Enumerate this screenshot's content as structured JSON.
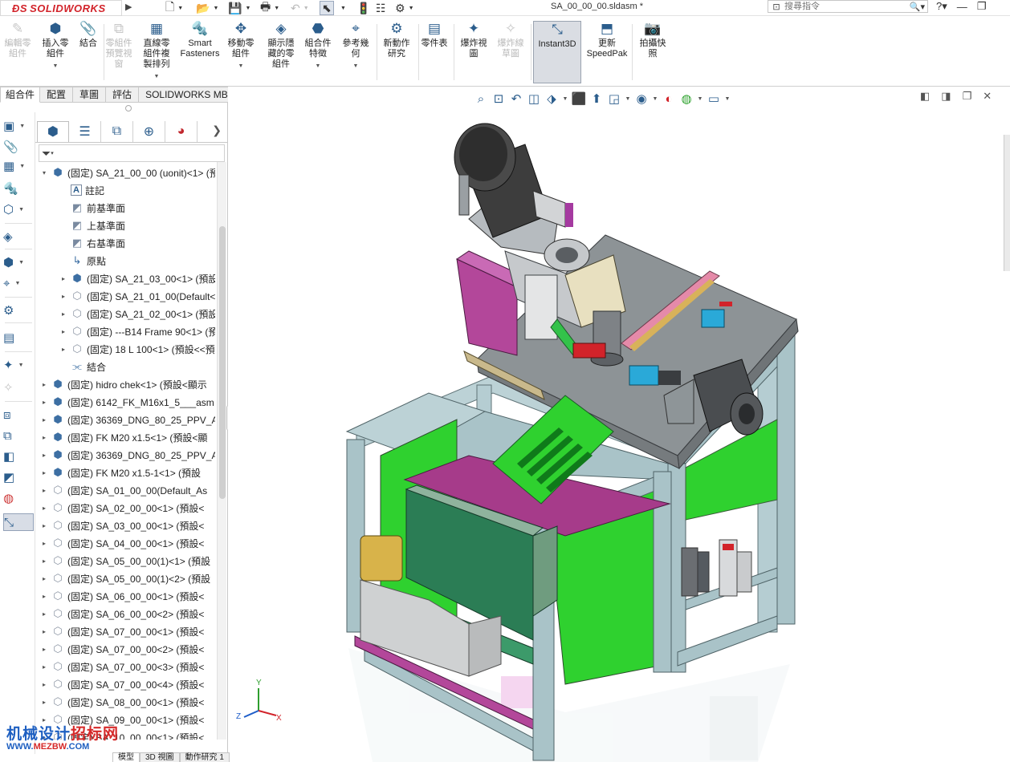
{
  "app": {
    "brand": "SOLIDWORKS",
    "document_title": "SA_00_00_00.sldasm *"
  },
  "search": {
    "placeholder": "搜尋指令"
  },
  "ribbon": [
    {
      "label": "編輯零\n組件",
      "icon": "edit-component-icon",
      "disabled": true
    },
    {
      "label": "插入零\n組件",
      "icon": "insert-component-icon",
      "disabled": false,
      "dropdown": true
    },
    {
      "label": "結合",
      "icon": "mate-icon",
      "disabled": false
    },
    {
      "label": "零組件\n預覽視\n窗",
      "icon": "component-preview-icon",
      "disabled": true
    },
    {
      "label": "直線零\n組件複\n製排列",
      "icon": "linear-pattern-icon",
      "disabled": false,
      "dropdown": true
    },
    {
      "label": "Smart\nFasteners",
      "icon": "smart-fasteners-icon",
      "disabled": false
    },
    {
      "label": "移動零\n組件",
      "icon": "move-component-icon",
      "disabled": false,
      "dropdown": true
    },
    {
      "label": "顯示隱\n藏的零\n組件",
      "icon": "show-hidden-icon",
      "disabled": false
    },
    {
      "label": "組合件\n特徵",
      "icon": "assembly-features-icon",
      "disabled": false,
      "dropdown": true
    },
    {
      "label": "參考幾\n何",
      "icon": "reference-geometry-icon",
      "disabled": false,
      "dropdown": true
    },
    {
      "label": "新動作\n研究",
      "icon": "motion-study-icon",
      "disabled": false
    },
    {
      "label": "零件表",
      "icon": "bom-icon",
      "disabled": false
    },
    {
      "label": "爆炸視\n圖",
      "icon": "exploded-view-icon",
      "disabled": false
    },
    {
      "label": "爆炸線\n草圖",
      "icon": "explode-line-sketch-icon",
      "disabled": true
    },
    {
      "label": "Instant3D",
      "icon": "instant3d-icon",
      "disabled": false,
      "active": true
    },
    {
      "label": "更新\nSpeedPak",
      "icon": "speedpak-icon",
      "disabled": false
    },
    {
      "label": "拍攝快\n照",
      "icon": "snapshot-icon",
      "disabled": false
    }
  ],
  "command_tabs": [
    "組合件",
    "配置",
    "草圖",
    "評估",
    "SOLIDWORKS MBD"
  ],
  "bottom_tabs": [
    "模型",
    "3D 視圖",
    "動作研究 1"
  ],
  "tree": [
    {
      "level": 0,
      "expand": "open",
      "icon": "assembly",
      "label": "(固定) SA_21_00_00 (uonit)<1> (預設"
    },
    {
      "level": 1,
      "expand": "none",
      "icon": "note",
      "label": "註記"
    },
    {
      "level": 1,
      "expand": "none",
      "icon": "plane",
      "label": "前基準面"
    },
    {
      "level": 1,
      "expand": "none",
      "icon": "plane",
      "label": "上基準面"
    },
    {
      "level": 1,
      "expand": "none",
      "icon": "plane",
      "label": "右基準面"
    },
    {
      "level": 1,
      "expand": "none",
      "icon": "origin",
      "label": "原點"
    },
    {
      "level": 1,
      "expand": "closed",
      "icon": "assembly",
      "label": "(固定) SA_21_03_00<1> (預設<"
    },
    {
      "level": 1,
      "expand": "closed",
      "icon": "part",
      "label": "(固定) SA_21_01_00(Default<"
    },
    {
      "level": 1,
      "expand": "closed",
      "icon": "part",
      "label": "(固定) SA_21_02_00<1> (預設<"
    },
    {
      "level": 1,
      "expand": "closed",
      "icon": "part",
      "label": "(固定) ---B14 Frame 90<1> (預"
    },
    {
      "level": 1,
      "expand": "closed",
      "icon": "part",
      "label": "(固定) 18 L 100<1> (預設<<預"
    },
    {
      "level": 1,
      "expand": "none",
      "icon": "mate",
      "label": "結合"
    },
    {
      "level": 0,
      "expand": "closed",
      "icon": "assembly",
      "label": "(固定) hidro chek<1> (預設<顯示"
    },
    {
      "level": 0,
      "expand": "closed",
      "icon": "assembly",
      "label": "(固定) 6142_FK_M16x1_5___asm"
    },
    {
      "level": 0,
      "expand": "closed",
      "icon": "assembly",
      "label": "(固定) 36369_DNG_80_25_PPV_A"
    },
    {
      "level": 0,
      "expand": "closed",
      "icon": "assembly",
      "label": "(固定) FK M20 x1.5<1> (預設<顯"
    },
    {
      "level": 0,
      "expand": "closed",
      "icon": "assembly",
      "label": "(固定) 36369_DNG_80_25_PPV_A"
    },
    {
      "level": 0,
      "expand": "closed",
      "icon": "assembly",
      "label": "(固定) FK M20 x1.5-1<1> (預設"
    },
    {
      "level": 0,
      "expand": "closed",
      "icon": "part",
      "label": "(固定) SA_01_00_00(Default_As"
    },
    {
      "level": 0,
      "expand": "closed",
      "icon": "part",
      "label": "(固定) SA_02_00_00<1> (預設<"
    },
    {
      "level": 0,
      "expand": "closed",
      "icon": "part",
      "label": "(固定) SA_03_00_00<1> (預設<"
    },
    {
      "level": 0,
      "expand": "closed",
      "icon": "part",
      "label": "(固定) SA_04_00_00<1> (預設<"
    },
    {
      "level": 0,
      "expand": "closed",
      "icon": "part",
      "label": "(固定) SA_05_00_00(1)<1> (預設"
    },
    {
      "level": 0,
      "expand": "closed",
      "icon": "part",
      "label": "(固定) SA_05_00_00(1)<2> (預設"
    },
    {
      "level": 0,
      "expand": "closed",
      "icon": "part",
      "label": "(固定) SA_06_00_00<1> (預設<"
    },
    {
      "level": 0,
      "expand": "closed",
      "icon": "part",
      "label": "(固定) SA_06_00_00<2> (預設<"
    },
    {
      "level": 0,
      "expand": "closed",
      "icon": "part",
      "label": "(固定) SA_07_00_00<1> (預設<"
    },
    {
      "level": 0,
      "expand": "closed",
      "icon": "part",
      "label": "(固定) SA_07_00_00<2> (預設<"
    },
    {
      "level": 0,
      "expand": "closed",
      "icon": "part",
      "label": "(固定) SA_07_00_00<3> (預設<"
    },
    {
      "level": 0,
      "expand": "closed",
      "icon": "part",
      "label": "(固定) SA_07_00_00<4> (預設<"
    },
    {
      "level": 0,
      "expand": "closed",
      "icon": "part",
      "label": "(固定) SA_08_00_00<1> (預設<"
    },
    {
      "level": 0,
      "expand": "closed",
      "icon": "part",
      "label": "(固定) SA_09_00_00<1> (預設<"
    },
    {
      "level": 0,
      "expand": "closed",
      "icon": "part",
      "label": "(固定) SA_10_00_00<1> (預設<"
    }
  ],
  "triad": {
    "x": "X",
    "y": "Y",
    "z": "Z"
  },
  "watermark": {
    "line1_a": "机械设计",
    "line1_b": "招标网",
    "line2_a": "WWW.",
    "line2_b": "MEZBW",
    "line2_c": ".COM"
  },
  "colors": {
    "frame": "#a9c3c8",
    "panel_green": "#2fd12f",
    "motor": "#3d3d3d",
    "magenta": "#b3479a",
    "plate": "#8d9396",
    "accent_red": "#d2232a"
  }
}
